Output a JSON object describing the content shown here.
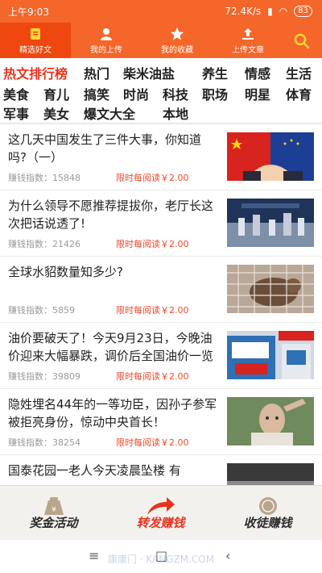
{
  "status": {
    "time": "上午9:03",
    "net": "72.4K/s",
    "battery": "83"
  },
  "nav": {
    "items": [
      {
        "label": "精选好文",
        "icon": "document-icon"
      },
      {
        "label": "我的上传",
        "icon": "person-icon"
      },
      {
        "label": "我的收藏",
        "icon": "star-icon"
      },
      {
        "label": "上传文章",
        "icon": "upload-icon"
      }
    ],
    "search_icon": "search-icon"
  },
  "categories": [
    "热文排行榜",
    "热门",
    "柴米油盐",
    "养生",
    "情感",
    "生活",
    "美食",
    "育儿",
    "搞笑",
    "时尚",
    "科技",
    "职场",
    "明星",
    "体育",
    "军事",
    "美女",
    "爆文大全",
    "本地"
  ],
  "articles": [
    {
      "title": "这几天中国发生了三件大事，你知道吗?（一）",
      "index_label": "赚钱指数：15848",
      "reward": "限时每阅读￥2.00"
    },
    {
      "title": "为什么领导不愿推荐提拔你，老厅长这次把话说透了!",
      "index_label": "赚钱指数：21426",
      "reward": "限时每阅读￥2.00"
    },
    {
      "title": "全球水貂数量知多少?",
      "index_label": "赚钱指数：5859",
      "reward": "限时每阅读￥2.00"
    },
    {
      "title": "油价要破天了！今天9月23日，今晚油价迎来大幅暴跌，调价后全国油价一览",
      "index_label": "赚钱指数：39809",
      "reward": "限时每阅读￥2.00"
    },
    {
      "title": "隐姓埋名44年的一等功臣，因孙子参军被拒亮身份，惊动中央首长！",
      "index_label": "赚钱指数：38254",
      "reward": "限时每阅读￥2.00"
    },
    {
      "title": "国泰花园一老人今天凌晨坠楼 有",
      "index_label": "",
      "reward": ""
    }
  ],
  "bottom": [
    {
      "label": "奖金活动",
      "icon": "bag-icon"
    },
    {
      "label": "转发赚钱",
      "icon": "share-arrow-icon"
    },
    {
      "label": "收徒赚钱",
      "icon": "coin-icon"
    }
  ],
  "watermark": "康康门 · KANGZM.COM",
  "sysnav": {
    "menu": "≡",
    "home": "□",
    "back": "‹"
  },
  "colors": {
    "brand": "#f4662a",
    "active_tab": "#ee4810",
    "accent_red": "#e8341e"
  }
}
